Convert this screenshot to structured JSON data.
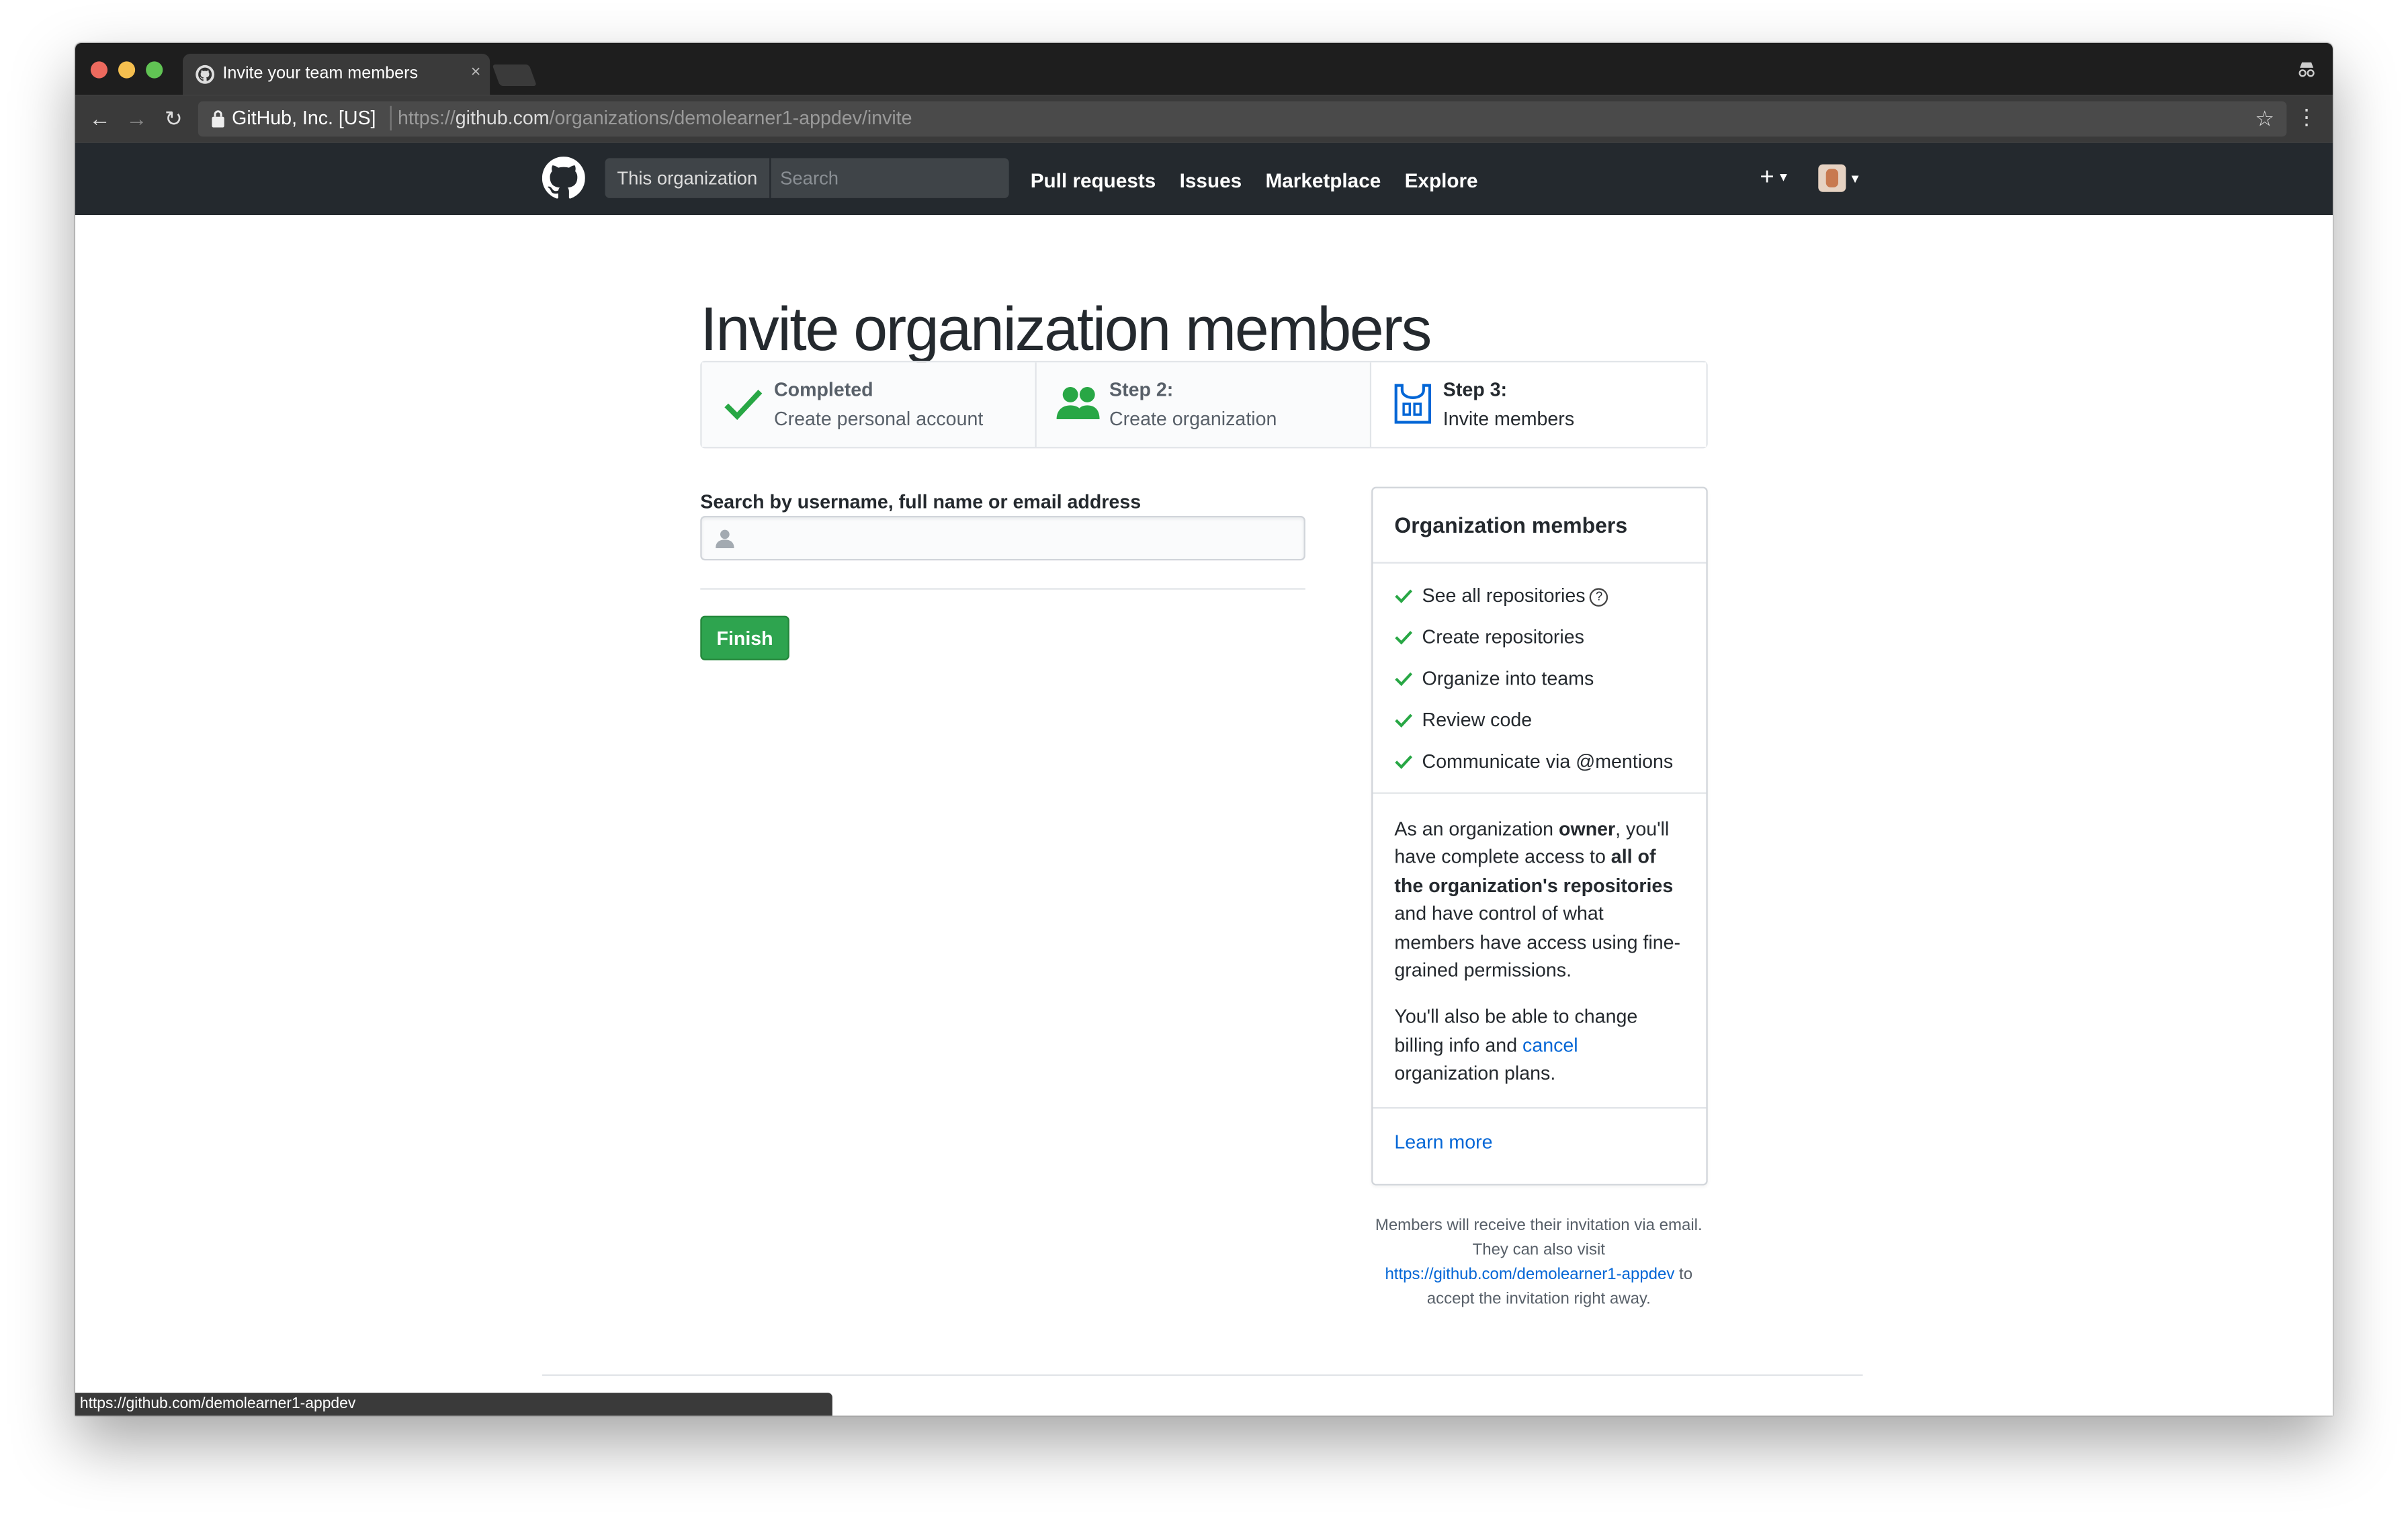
{
  "browser": {
    "tab_title": "Invite your team members",
    "tab_close": "×",
    "site_identity": "GitHub, Inc. [US]",
    "url_prefix": "https://",
    "url_host": "github.com",
    "url_path": "/organizations/demolearner1-appdev/invite",
    "status_url": "https://github.com/demolearner1-appdev"
  },
  "header": {
    "scope_label": "This organization",
    "search_placeholder": "Search",
    "nav": [
      "Pull requests",
      "Issues",
      "Marketplace",
      "Explore"
    ],
    "plus_label": "+"
  },
  "main": {
    "title": "Invite organization members",
    "steps": [
      {
        "label": "Completed",
        "desc": "Create personal account"
      },
      {
        "label": "Step 2:",
        "desc": "Create organization"
      },
      {
        "label": "Step 3:",
        "desc": "Invite members"
      }
    ],
    "search_label": "Search by username, full name or email address",
    "search_value": "",
    "finish_label": "Finish"
  },
  "sidebar": {
    "title": "Organization members",
    "permissions": [
      "See all repositories",
      "Create repositories",
      "Organize into teams",
      "Review code",
      "Communicate via @mentions"
    ],
    "help_glyph": "?",
    "owner_p1": {
      "a": "As an organization ",
      "b": "owner",
      "c": ", you'll have complete access to ",
      "d": "all of the organization's repositories",
      "e": " and have control of what members have access using fine-grained permissions."
    },
    "owner_p2": {
      "a": "You'll also be able to change billing info and ",
      "link": "cancel",
      "b": " organization plans."
    },
    "learn_more": "Learn more"
  },
  "note": {
    "a": "Members will receive their invitation via email. They can also visit ",
    "link": "https://github.com/demolearner1-appdev",
    "b": " to accept the invitation right away."
  },
  "colors": {
    "header_bg": "#24292e",
    "success_green": "#28a745",
    "link_blue": "#0366d6",
    "step_icon_blue": "#0366d6"
  }
}
